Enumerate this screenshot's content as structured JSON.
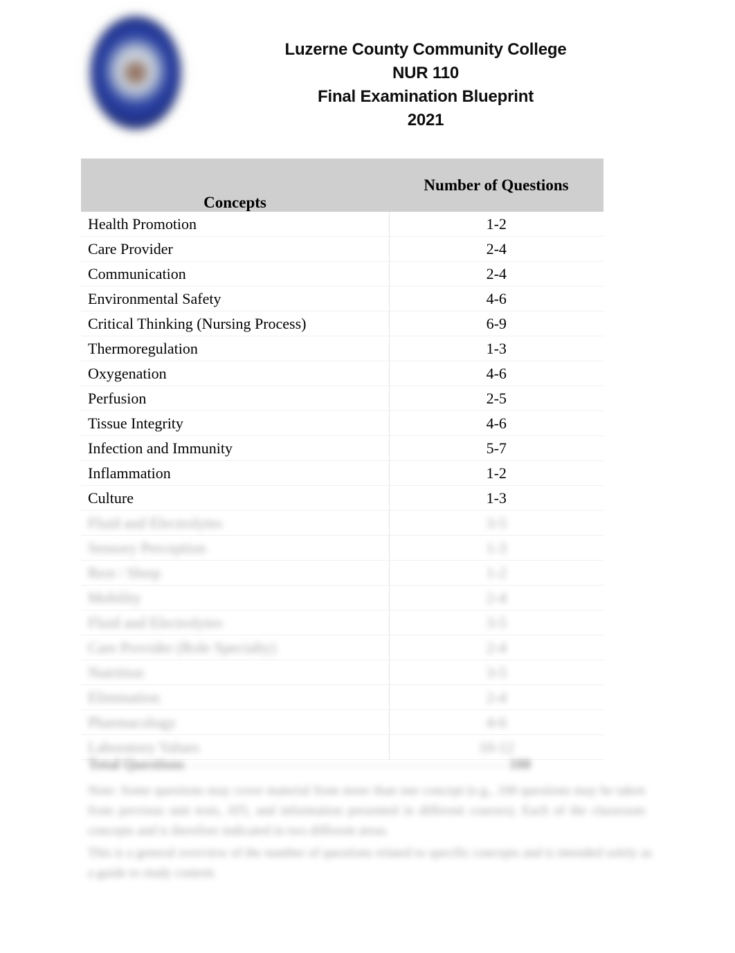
{
  "document": {
    "institution": "Luzerne County Community College",
    "course": "NUR 110",
    "doc_title": "Final Examination Blueprint",
    "year": "2021",
    "logo": "college-seal-logo"
  },
  "table": {
    "columns": {
      "concepts": "Concepts",
      "number_of_questions": "Number of Questions"
    },
    "rows": [
      {
        "concept": "Health Promotion",
        "questions": "1-2",
        "redacted": false
      },
      {
        "concept": "Care Provider",
        "questions": "2-4",
        "redacted": false
      },
      {
        "concept": "Communication",
        "questions": "2-4",
        "redacted": false
      },
      {
        "concept": "Environmental Safety",
        "questions": "4-6",
        "redacted": false
      },
      {
        "concept": "Critical Thinking (Nursing Process)",
        "questions": "6-9",
        "redacted": false
      },
      {
        "concept": "Thermoregulation",
        "questions": "1-3",
        "redacted": false
      },
      {
        "concept": "Oxygenation",
        "questions": "4-6",
        "redacted": false
      },
      {
        "concept": "Perfusion",
        "questions": "2-5",
        "redacted": false
      },
      {
        "concept": "Tissue Integrity",
        "questions": "4-6",
        "redacted": false
      },
      {
        "concept": "Infection and Immunity",
        "questions": "5-7",
        "redacted": false
      },
      {
        "concept": "Inflammation",
        "questions": "1-2",
        "redacted": false
      },
      {
        "concept": "Culture",
        "questions": "1-3",
        "redacted": false
      },
      {
        "concept": "Fluid and Electrolytes",
        "questions": "3-5",
        "redacted": true
      },
      {
        "concept": "Sensory Perception",
        "questions": "1-3",
        "redacted": true
      },
      {
        "concept": "Rest / Sleep",
        "questions": "1-2",
        "redacted": true
      },
      {
        "concept": "Mobility",
        "questions": "2-4",
        "redacted": true
      },
      {
        "concept": "Fluid and Electrolytes",
        "questions": "3-5",
        "redacted": true
      },
      {
        "concept": "Care Provider (Role Specialty)",
        "questions": "2-4",
        "redacted": true
      },
      {
        "concept": "Nutrition",
        "questions": "3-5",
        "redacted": true
      },
      {
        "concept": "Elimination",
        "questions": "2-4",
        "redacted": true
      },
      {
        "concept": "Pharmacology",
        "questions": "4-6",
        "redacted": true
      },
      {
        "concept": "Laboratory Values",
        "questions": "10-12",
        "redacted": true
      }
    ]
  },
  "total": {
    "label": "Total Questions",
    "value": "100"
  },
  "notes": {
    "note_1": "Note: Some questions may cover material from more than one concept (e.g., 100 questions may be taken from previous unit tests, ATI, and information presented in different courses). Each of the classroom concepts and is therefore indicated in two different areas.",
    "note_2": "This is a general overview of the number of questions related to specific concepts and is intended solely as a guide to study content."
  }
}
